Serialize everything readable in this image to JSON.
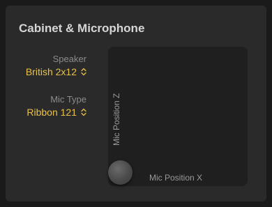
{
  "panel": {
    "title": "Cabinet & Microphone"
  },
  "speaker": {
    "label": "Speaker",
    "value": "British 2x12"
  },
  "mic_type": {
    "label": "Mic Type",
    "value": "Ribbon 121"
  },
  "xy_pad": {
    "label_x": "Mic Position X",
    "label_z": "Mic Position Z",
    "position_x": 0.0,
    "position_z": 0.0
  },
  "colors": {
    "accent": "#e8c24a",
    "panel_bg": "#2a2a2a",
    "pad_bg": "#1f1f1f"
  }
}
